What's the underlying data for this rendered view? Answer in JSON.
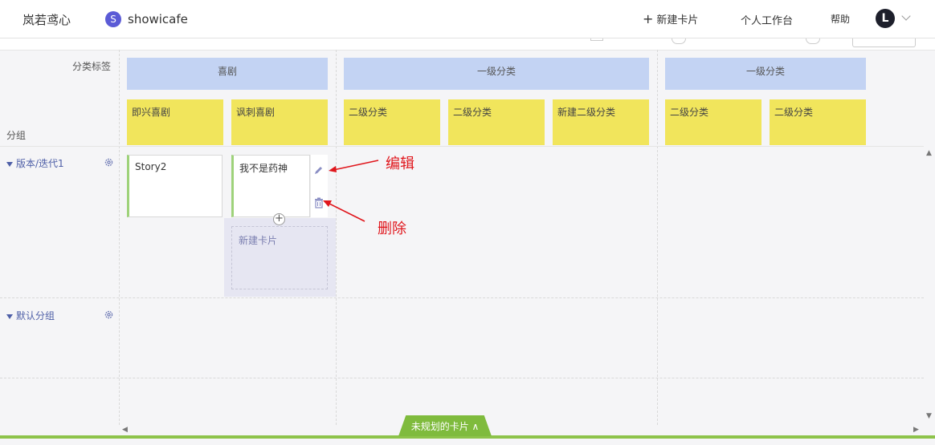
{
  "header": {
    "brand": "岚若鸢心",
    "project_badge": "S",
    "project_name": "showicafe",
    "new_card_label": "新建卡片",
    "workspace_label": "个人工作台",
    "help_label": "帮助",
    "avatar_letter": "L"
  },
  "board": {
    "category_label": "分类标签",
    "group_label": "分组",
    "categories": [
      {
        "label": "喜剧",
        "subcategories": [
          "即兴喜剧",
          "讽刺喜剧"
        ]
      },
      {
        "label": "一级分类",
        "subcategories": [
          "二级分类",
          "二级分类",
          "新建二级分类"
        ]
      },
      {
        "label": "一级分类",
        "subcategories": [
          "二级分类",
          "二级分类"
        ]
      }
    ],
    "rows": [
      {
        "label": "版本/迭代1"
      },
      {
        "label": "默认分组"
      }
    ],
    "cards": [
      {
        "title": "Story2"
      },
      {
        "title": "我不是药神"
      }
    ],
    "new_card_slot_label": "新建卡片",
    "add_glyph": "+"
  },
  "annotations": {
    "edit_label": "编辑",
    "delete_label": "删除"
  },
  "footer": {
    "unplanned_label": "未规划的卡片 ∧"
  },
  "colors": {
    "category_header": "#c3d3f3",
    "subcategory_header": "#f1e55c",
    "card_accent": "#9ed27a",
    "annotation": "#e0161c",
    "bottom_bar": "#8dc34a",
    "project_badge": "#5b5bd6"
  }
}
